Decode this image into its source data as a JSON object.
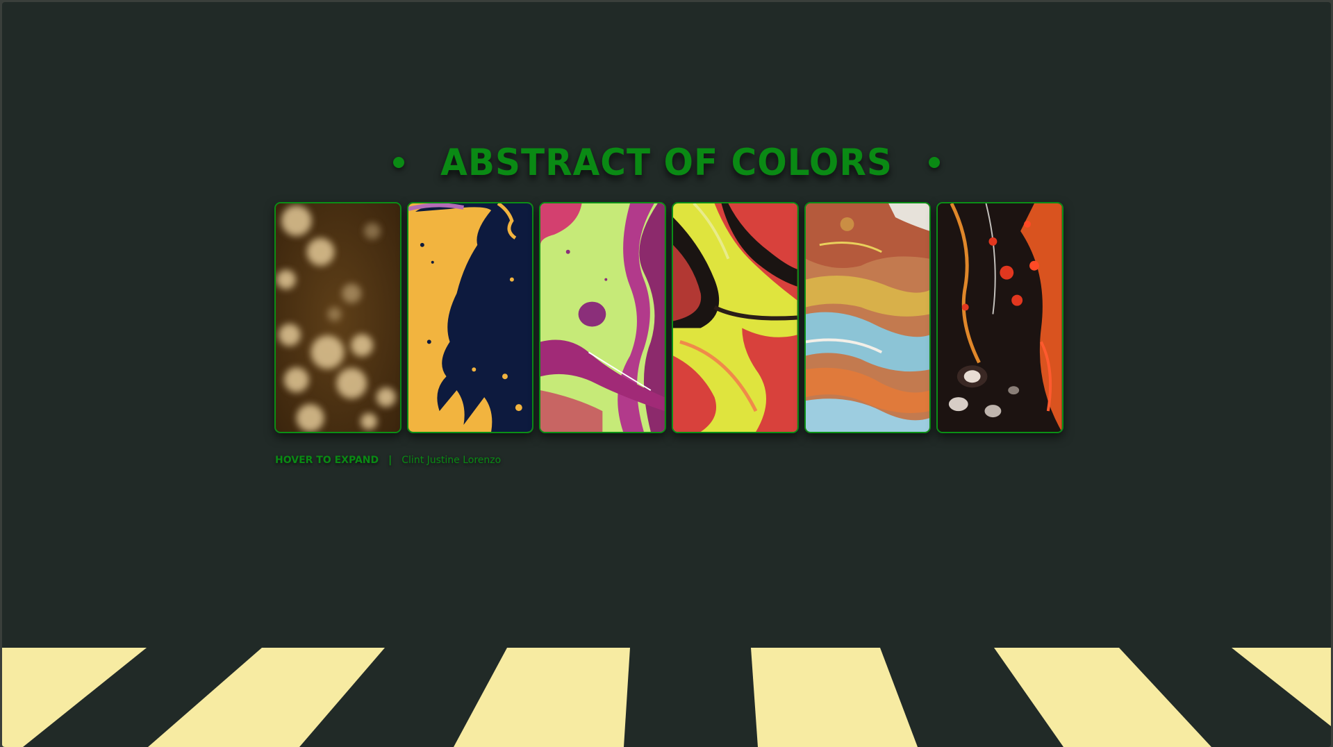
{
  "header": {
    "title": "ABSTRACT OF COLORS"
  },
  "gallery": {
    "cards": [
      {
        "name": "brown-bokeh",
        "colors": [
          "#4a3113",
          "#d9bd8a"
        ]
      },
      {
        "name": "yellow-navy-splash",
        "colors": [
          "#f6b53e",
          "#0d1a3e"
        ]
      },
      {
        "name": "lime-magenta-swirl",
        "colors": [
          "#c3ea73",
          "#b0286b"
        ]
      },
      {
        "name": "red-yellow-fluid",
        "colors": [
          "#d83a3a",
          "#dde33c"
        ]
      },
      {
        "name": "rust-blue-fluid",
        "colors": [
          "#c8653a",
          "#8ec6d8"
        ]
      },
      {
        "name": "black-orange-cells",
        "colors": [
          "#1b1210",
          "#e3541d"
        ]
      }
    ]
  },
  "footer": {
    "hint": "HOVER TO EXPAND",
    "separator": "|",
    "author": "Clint Justine Lorenzo"
  },
  "colors": {
    "background": "#212a27",
    "accent": "#0a8a14",
    "stripe": "#f7eba2"
  }
}
